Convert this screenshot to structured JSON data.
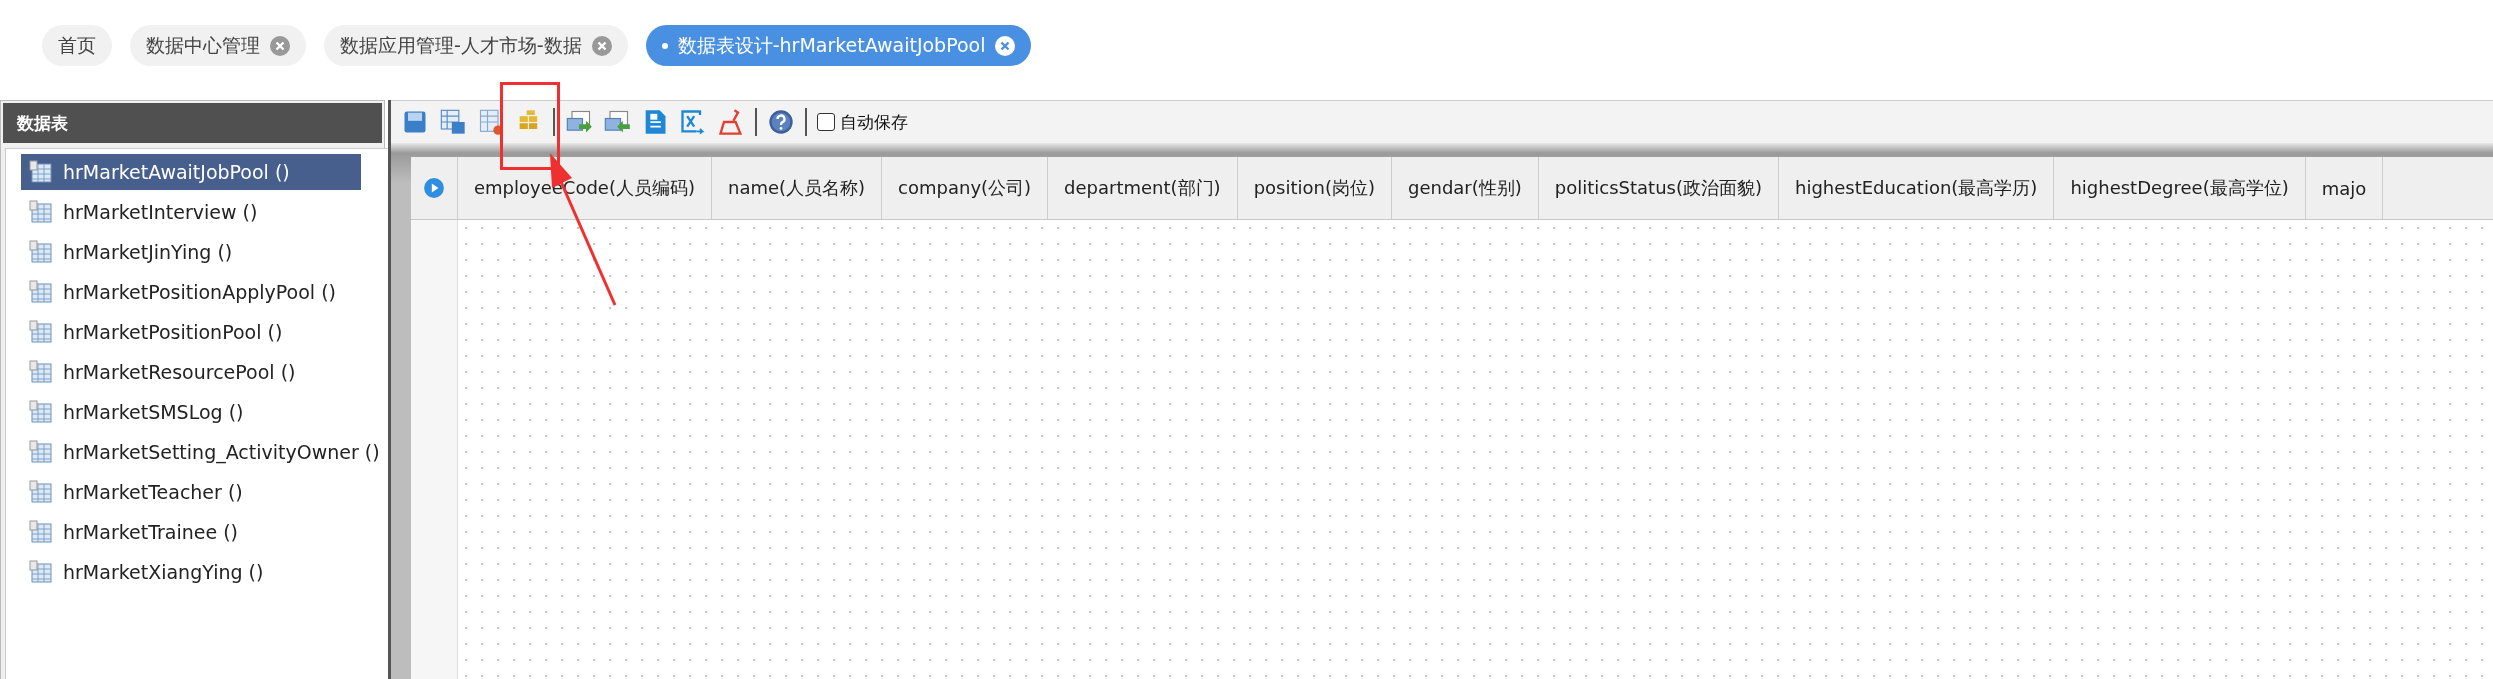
{
  "tabs": [
    {
      "label": "首页",
      "closable": false,
      "selected": false
    },
    {
      "label": "数据中心管理",
      "closable": true,
      "selected": false
    },
    {
      "label": "数据应用管理-人才市场-数据",
      "closable": true,
      "selected": false
    },
    {
      "label": "数据表设计-hrMarketAwaitJobPool",
      "closable": true,
      "selected": true
    }
  ],
  "sidebar": {
    "title": "数据表",
    "items": [
      {
        "label": "hrMarketAwaitJobPool ()",
        "selected": true
      },
      {
        "label": "hrMarketInterview ()",
        "selected": false
      },
      {
        "label": "hrMarketJinYing ()",
        "selected": false
      },
      {
        "label": "hrMarketPositionApplyPool ()",
        "selected": false
      },
      {
        "label": "hrMarketPositionPool ()",
        "selected": false
      },
      {
        "label": "hrMarketResourcePool ()",
        "selected": false
      },
      {
        "label": "hrMarketSMSLog ()",
        "selected": false
      },
      {
        "label": "hrMarketSetting_ActivityOwner ()",
        "selected": false
      },
      {
        "label": "hrMarketTeacher ()",
        "selected": false
      },
      {
        "label": "hrMarketTrainee ()",
        "selected": false
      },
      {
        "label": "hrMarketXiangYing ()",
        "selected": false
      }
    ]
  },
  "toolbar": {
    "autosave": {
      "label": "自动保存",
      "checked": false
    }
  },
  "table": {
    "columns": [
      "employeeCode(人员编码)",
      "name(人员名称)",
      "company(公司)",
      "department(部门)",
      "position(岗位)",
      "gendar(性别)",
      "politicsStatus(政治面貌)",
      "highestEducation(最高学历)",
      "highestDegree(最高学位)",
      "majo"
    ]
  }
}
